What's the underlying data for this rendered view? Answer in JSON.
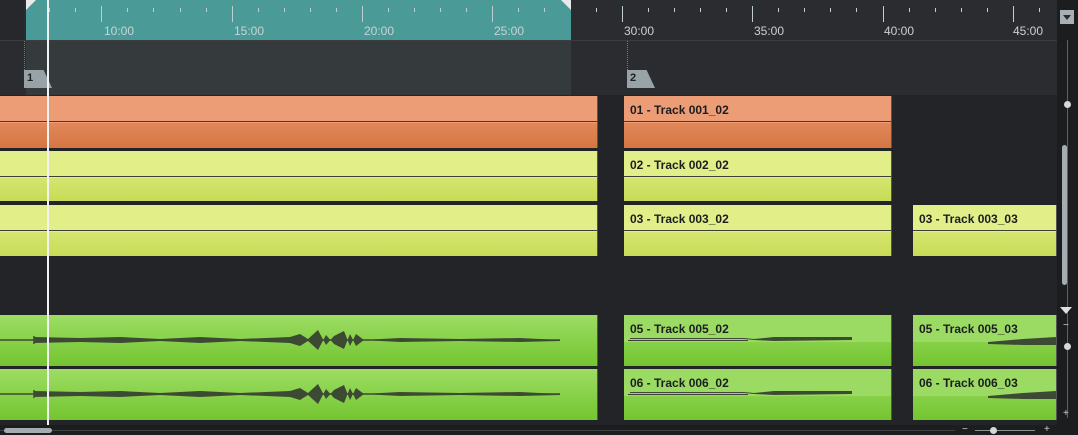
{
  "ruler": {
    "labels": [
      "10:00",
      "15:00",
      "20:00",
      "25:00",
      "30:00",
      "35:00",
      "40:00",
      "45:00"
    ]
  },
  "markers": [
    "1",
    "2"
  ],
  "clips": {
    "track1_clip2": "01 - Track 001_02",
    "track2_clip2": "02 - Track 002_02",
    "track3_clip2": "03 - Track 003_02",
    "track3_clip3": "03 - Track 003_03",
    "track5_clip2": "05 - Track 005_02",
    "track5_clip3": "05 - Track 005_03",
    "track6_clip2": "06 - Track 006_02",
    "track6_clip3": "06 - Track 006_03"
  },
  "zoom": {
    "minus": "−",
    "plus": "+"
  },
  "colors": {
    "cycle": "#4a9b98",
    "orange": "#e08450",
    "yellow": "#d8e774",
    "green": "#86d04a"
  }
}
